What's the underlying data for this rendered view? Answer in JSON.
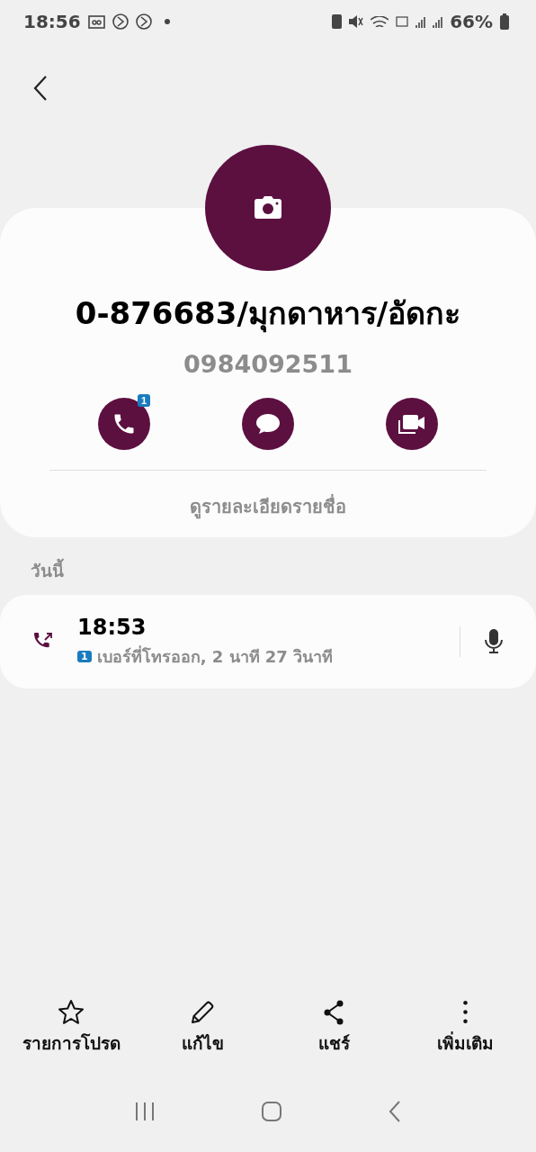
{
  "status_bar": {
    "time": "18:56",
    "battery": "66%"
  },
  "contact": {
    "name": "0-876683/มุกดาหาร/อัดกะ",
    "number": "0984092511",
    "details_link": "ดูรายละเอียดรายชื่อ"
  },
  "actions": [
    {
      "kind": "call",
      "badge": "1"
    },
    {
      "kind": "message"
    },
    {
      "kind": "video"
    }
  ],
  "history": {
    "heading": "วันนี้",
    "entries": [
      {
        "kind": "outgoing",
        "time": "18:53",
        "sim": "1",
        "description": "เบอร์ที่โทรออก, 2 นาที 27 วินาที"
      }
    ]
  },
  "toolbar": [
    {
      "kind": "favorite",
      "label": "รายการโปรด"
    },
    {
      "kind": "edit",
      "label": "แก้ไข"
    },
    {
      "kind": "share",
      "label": "แชร์"
    },
    {
      "kind": "more",
      "label": "เพิ่มเติม"
    }
  ]
}
